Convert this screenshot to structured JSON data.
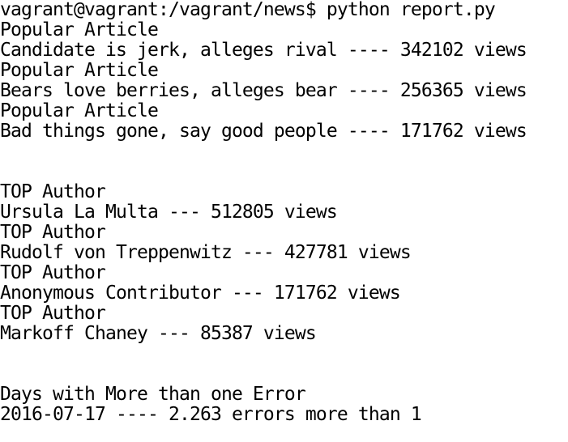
{
  "terminal": {
    "prompt": "vagrant@vagrant:/vagrant/news$ python report.py",
    "articles": [
      {
        "heading": "Popular Article",
        "text": "Candidate is jerk, alleges rival ---- 342102 views"
      },
      {
        "heading": "Popular Article",
        "text": "Bears love berries, alleges bear ---- 256365 views"
      },
      {
        "heading": "Popular Article",
        "text": "Bad things gone, say good people ---- 171762 views"
      }
    ],
    "authors": [
      {
        "heading": "TOP Author",
        "text": "Ursula La Multa --- 512805 views"
      },
      {
        "heading": "TOP Author",
        "text": "Rudolf von Treppenwitz --- 427781 views"
      },
      {
        "heading": "TOP Author",
        "text": "Anonymous Contributor --- 171762 views"
      },
      {
        "heading": "TOP Author",
        "text": "Markoff Chaney --- 85387 views"
      }
    ],
    "errors": {
      "heading": "Days with More than one Error",
      "text": "2016-07-17 ---- 2.263 errors more than 1"
    }
  }
}
